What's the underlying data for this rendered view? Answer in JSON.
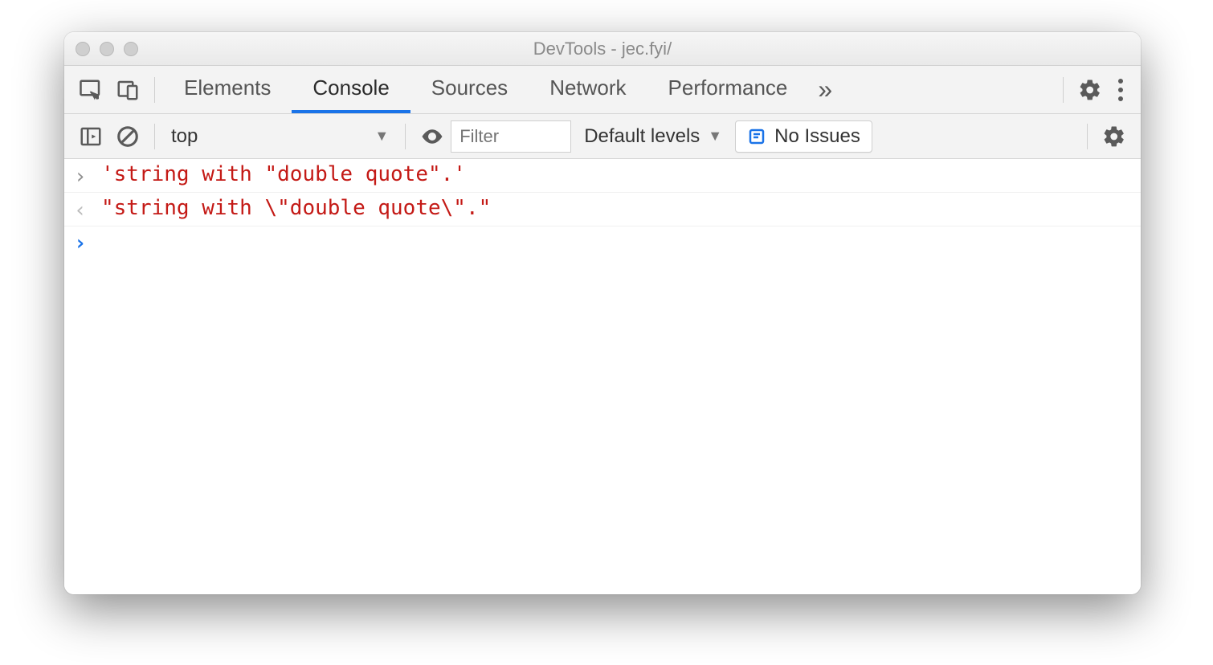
{
  "window": {
    "title": "DevTools - jec.fyi/"
  },
  "tabs": {
    "items": [
      "Elements",
      "Console",
      "Sources",
      "Network",
      "Performance"
    ],
    "active_index": 1,
    "overflow_glyph": "»"
  },
  "toolbar": {
    "context": "top",
    "filter_placeholder": "Filter",
    "levels_label": "Default levels",
    "issues_label": "No Issues"
  },
  "console": {
    "lines": [
      {
        "kind": "input",
        "marker": "›",
        "text": "'string with \"double quote\".'"
      },
      {
        "kind": "output",
        "marker": "‹",
        "text": "\"string with \\\"double quote\\\".\""
      }
    ],
    "prompt_marker": "›"
  }
}
